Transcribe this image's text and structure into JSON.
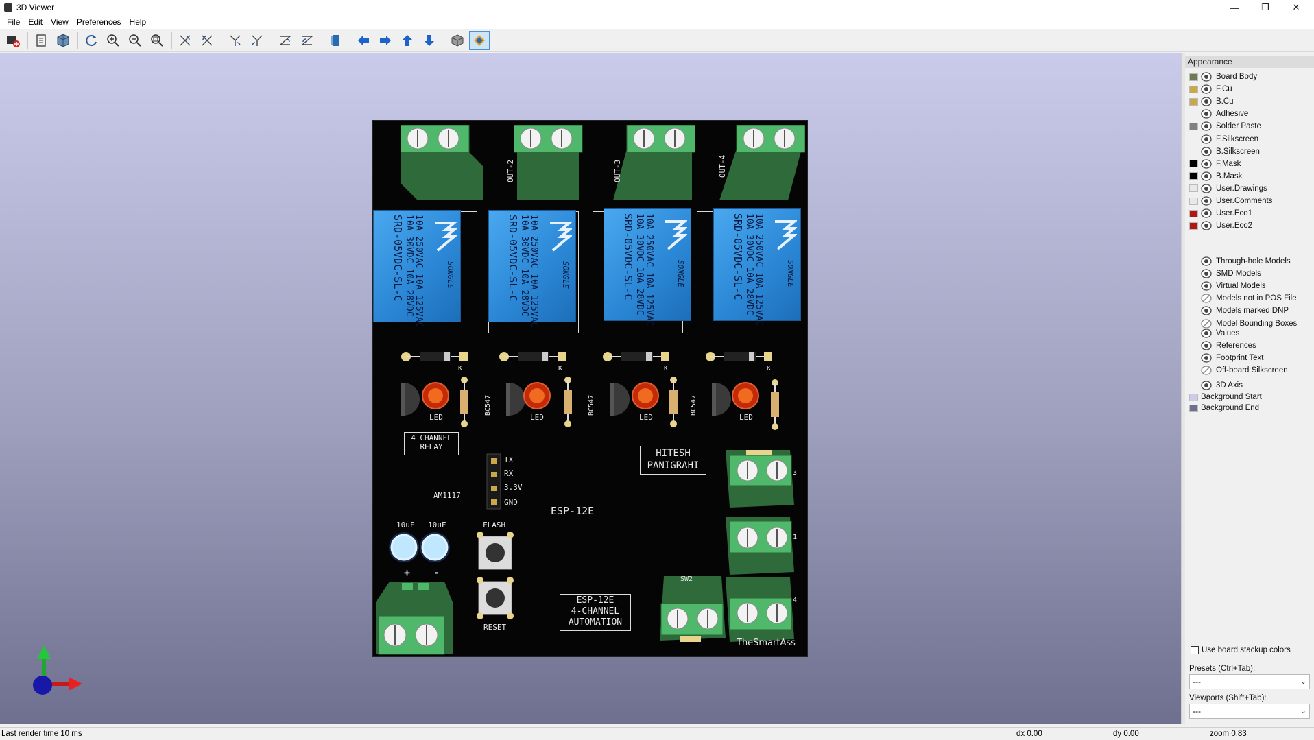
{
  "window": {
    "title": "3D Viewer",
    "minimize": "—",
    "restore": "❐",
    "close": "✕"
  },
  "menu": [
    "File",
    "Edit",
    "View",
    "Preferences",
    "Help"
  ],
  "toolbar": {
    "icons": [
      "render-icon",
      "copy-icon",
      "raytrace-icon",
      "reload-icon",
      "zoom-in-icon",
      "zoom-out-icon",
      "zoom-fit-icon",
      "rotate-x-icon",
      "rotate-x-ccw-icon",
      "rotate-y-icon",
      "rotate-y-ccw-icon",
      "rotate-z-icon",
      "rotate-z-ccw-icon",
      "flip-board-icon",
      "move-left-icon",
      "move-right-icon",
      "move-up-icon",
      "move-down-icon",
      "orthographic-icon",
      "layers-manager-icon"
    ]
  },
  "board": {
    "out_labels": [
      "OUT-2",
      "OUT-3",
      "OUT-4"
    ],
    "relay_text": [
      "10A 250VAC 10A 125VAC",
      "10A 30VDC 10A 28VDC",
      "SRD-05VDC-SL-C"
    ],
    "relay_brand": "SONGLE",
    "diode_mark": "K",
    "transistor": "BC547",
    "led": "LED",
    "channel_label_1": "4 CHANNEL",
    "channel_label_2": "RELAY",
    "header_pins": [
      "TX",
      "RX",
      "3.3V",
      "GND"
    ],
    "regulator": "AM1117",
    "module": "ESP-12E",
    "author_1": "HITESH",
    "author_2": "PANIGRAHI",
    "cap_label": "10uF",
    "flash": "FLASH",
    "reset": "RESET",
    "plus": "+",
    "minus": "-",
    "sw": "SW2",
    "title_1": "ESP-12E",
    "title_2": "4-CHANNEL",
    "title_3": "AUTOMATION",
    "brand": "TheSmartAss",
    "term_nums": [
      "3",
      "1",
      "4"
    ]
  },
  "appearance": {
    "header": "Appearance",
    "layers": [
      {
        "name": "Board Body",
        "color": "#6e7a52"
      },
      {
        "name": "F.Cu",
        "color": "#c8a84a"
      },
      {
        "name": "B.Cu",
        "color": "#c8a84a"
      },
      {
        "name": "Adhesive",
        "color": ""
      },
      {
        "name": "Solder Paste",
        "color": "#808080"
      },
      {
        "name": "F.Silkscreen",
        "color": ""
      },
      {
        "name": "B.Silkscreen",
        "color": ""
      },
      {
        "name": "F.Mask",
        "color": "#000000"
      },
      {
        "name": "B.Mask",
        "color": "#000000"
      },
      {
        "name": "User.Drawings",
        "color": "#e8e8e8"
      },
      {
        "name": "User.Comments",
        "color": "#e8e8e8"
      },
      {
        "name": "User.Eco1",
        "color": "#b01818"
      },
      {
        "name": "User.Eco2",
        "color": "#b01818"
      }
    ],
    "models": [
      {
        "name": "Through-hole Models",
        "visible": true
      },
      {
        "name": "SMD Models",
        "visible": true
      },
      {
        "name": "Virtual Models",
        "visible": true
      },
      {
        "name": "Models not in POS File",
        "visible": false
      },
      {
        "name": "Models marked DNP",
        "visible": true
      },
      {
        "name": "Model Bounding Boxes",
        "visible": false
      }
    ],
    "text": [
      {
        "name": "Values",
        "visible": true
      },
      {
        "name": "References",
        "visible": true
      },
      {
        "name": "Footprint Text",
        "visible": true
      },
      {
        "name": "Off-board Silkscreen",
        "visible": false
      }
    ],
    "axis": "3D Axis",
    "bg_start": {
      "name": "Background Start",
      "color": "#ccccea"
    },
    "bg_end": {
      "name": "Background End",
      "color": "#6f6f8f"
    },
    "stackup": "Use board stackup colors",
    "presets_label": "Presets (Ctrl+Tab):",
    "presets_value": "---",
    "viewports_label": "Viewports (Shift+Tab):",
    "viewports_value": "---"
  },
  "status": {
    "render": "Last render time 10 ms",
    "dx": "dx 0.00",
    "dy": "dy 0.00",
    "zoom": "zoom 0.83"
  }
}
